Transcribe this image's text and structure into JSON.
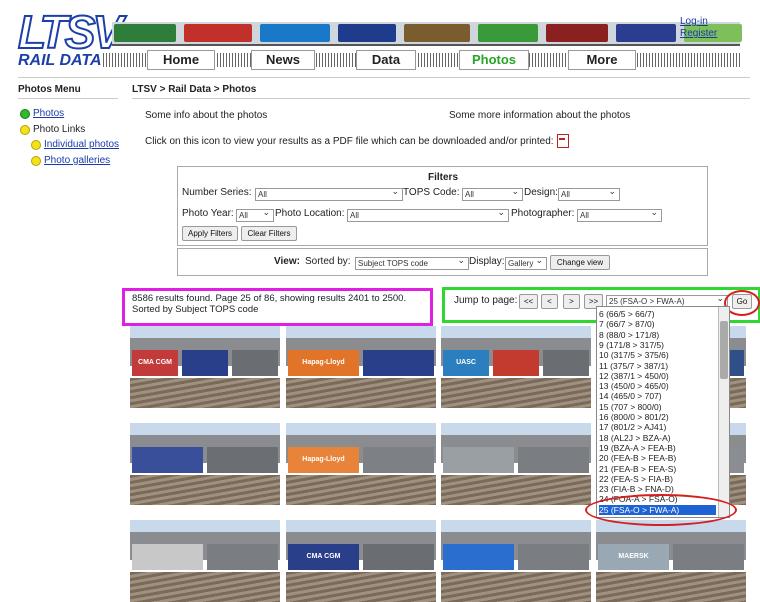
{
  "header": {
    "logo_top": "LTSV",
    "logo_bottom": "RAIL DATA",
    "nav": [
      "Home",
      "News",
      "Data",
      "Photos",
      "More"
    ],
    "active_nav": "Photos",
    "login": "Log-in",
    "register": "Register",
    "train_colors": [
      "#2f7d3a",
      "#c2302c",
      "#1a78c8",
      "#1f3b8c",
      "#7a5c2e",
      "#3a9a3a",
      "#8a2020",
      "#2a3d8f",
      "#7fbf5a"
    ]
  },
  "menu": {
    "title": "Photos Menu",
    "items": [
      {
        "label": "Photos",
        "level": 0,
        "dot": "green",
        "link": true
      },
      {
        "label": "Photo Links",
        "level": 0,
        "dot": "yellow",
        "link": false
      },
      {
        "label": "Individual photos",
        "level": 1,
        "dot": "yellow",
        "link": true
      },
      {
        "label": "Photo galleries",
        "level": 1,
        "dot": "yellow",
        "link": true
      }
    ]
  },
  "main": {
    "breadcrumb": "LTSV > Rail Data > Photos",
    "info_left": "Some info about the photos",
    "info_right": "Some more information about the photos",
    "pdf_text": "Click on this icon to view your results as a PDF file which can be downloaded and/or printed:"
  },
  "filters": {
    "title": "Filters",
    "number_series_label": "Number Series:",
    "number_series_value": "All",
    "tops_code_label": "TOPS Code:",
    "tops_code_value": "All",
    "design_label": "Design:",
    "design_value": "All",
    "photo_year_label": "Photo Year:",
    "photo_year_value": "All",
    "photo_location_label": "Photo Location:",
    "photo_location_value": "All",
    "photographer_label": "Photographer:",
    "photographer_value": "All",
    "apply_label": "Apply Filters",
    "clear_label": "Clear Filters"
  },
  "view": {
    "view_label": "View:",
    "sorted_label": "Sorted by:",
    "sorted_value": "Subject TOPS code",
    "display_label": "Display:",
    "display_value": "Gallery",
    "change_label": "Change view"
  },
  "results": {
    "line1": "8586 results found. Page 25 of 86, showing results 2401 to 2500.",
    "line2": "Sorted by Subject TOPS code"
  },
  "pager": {
    "jump_label": "Jump to page:",
    "first": "<<",
    "prev": "<",
    "next": ">",
    "last": ">>",
    "page_value": "25 (FSA-O > FWA-A)",
    "go": "Go"
  },
  "dropdown_options": [
    "6 (66/5 > 66/7)",
    "7 (66/7 > 87/0)",
    "8 (88/0 > 171/8)",
    "9 (171/8 > 317/5)",
    "10 (317/5 > 375/6)",
    "11 (375/7 > 387/1)",
    "12 (387/1 > 450/0)",
    "13 (450/0 > 465/0)",
    "14 (465/0 > 707)",
    "15 (707 > 800/0)",
    "16 (800/0 > 801/2)",
    "17 (801/2 > AJ41)",
    "18 (AL2J > BZA-A)",
    "19 (BZA-A > FEA-B)",
    "20 (FEA-B > FEA-B)",
    "21 (FEA-B > FEA-S)",
    "22 (FEA-S > FIA-B)",
    "23 (FIA-B > FNA-D)",
    "24 (FOA-A > FSA-O)",
    "25 (FSA-O > FWA-A)"
  ],
  "dropdown_selected_index": 19,
  "thumbnails": [
    {
      "label": "CMA CGM",
      "colors": [
        "#c23a3a",
        "#2a3f8a",
        "#6a6e72"
      ]
    },
    {
      "label": "Hapag-Lloyd",
      "colors": [
        "#e2742a",
        "#2a3f8a"
      ]
    },
    {
      "label": "UASC",
      "colors": [
        "#2c7fbf",
        "#c33a2e",
        "#6a6e72"
      ]
    },
    {
      "label": "",
      "colors": [
        "#555b60",
        "#2f4f88"
      ]
    },
    {
      "label": "",
      "colors": [
        "#3a4f9a",
        "#6b6f73"
      ]
    },
    {
      "label": "Hapag-Lloyd",
      "colors": [
        "#e8843a",
        "#7d8085"
      ]
    },
    {
      "label": "",
      "colors": [
        "#9a9fa4",
        "#7a7e82"
      ]
    },
    {
      "label": "",
      "colors": [
        "#4a5a7a",
        "#8a8e92"
      ]
    },
    {
      "label": "",
      "colors": [
        "#c8c8c8",
        "#7a7e82"
      ]
    },
    {
      "label": "CMA CGM",
      "colors": [
        "#2a3f8a",
        "#6a6e72"
      ]
    },
    {
      "label": "",
      "colors": [
        "#2a6fd0",
        "#7a7e82"
      ]
    },
    {
      "label": "MAERSK",
      "colors": [
        "#9aa8b3",
        "#7a7e82"
      ]
    }
  ]
}
